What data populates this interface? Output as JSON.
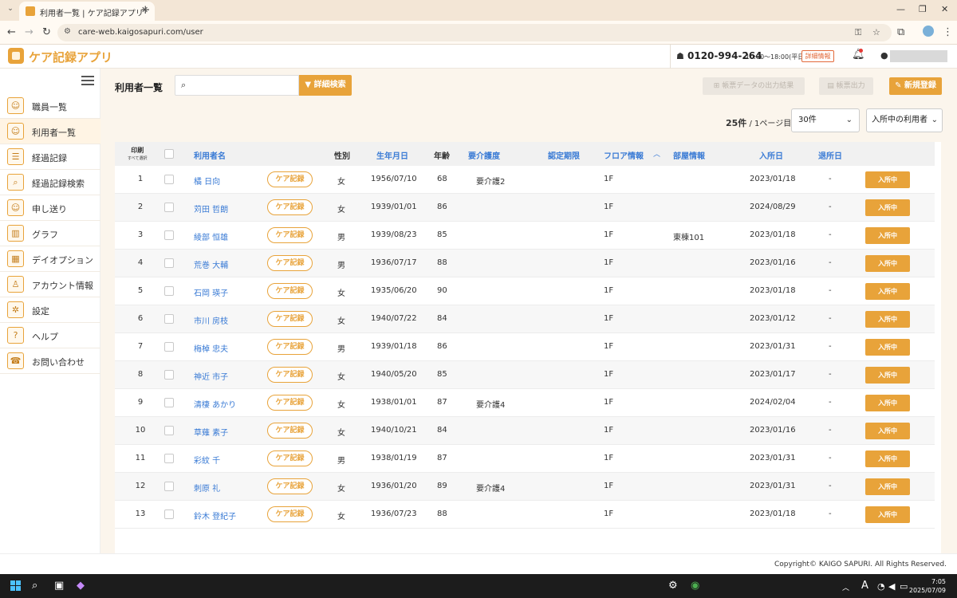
{
  "browser": {
    "tab_title": "利用者一覧 | ケア記録アプリ",
    "url": "care-web.kaigosapuri.com/user"
  },
  "header": {
    "app_name": "ケア記録アプリ",
    "phone": "0120-994-264",
    "hours": "10:00〜18:00(平日)",
    "detail_label": "詳細情報"
  },
  "sidebar": {
    "items": [
      {
        "label": "職員一覧",
        "icon": "staff-icon"
      },
      {
        "label": "利用者一覧",
        "icon": "user-list-icon"
      },
      {
        "label": "経過記録",
        "icon": "progress-record-icon"
      },
      {
        "label": "経過記録検索",
        "icon": "record-search-icon"
      },
      {
        "label": "申し送り",
        "icon": "handover-icon"
      },
      {
        "label": "グラフ",
        "icon": "graph-icon"
      },
      {
        "label": "デイオプション",
        "icon": "day-option-icon"
      },
      {
        "label": "アカウント情報",
        "icon": "account-icon"
      },
      {
        "label": "設定",
        "icon": "settings-icon"
      },
      {
        "label": "ヘルプ",
        "icon": "help-icon"
      },
      {
        "label": "お問い合わせ",
        "icon": "contact-icon"
      }
    ]
  },
  "main": {
    "title": "利用者一覧",
    "search_placeholder": "",
    "advanced_search": "詳細検索",
    "export_results": "帳票データの出力結果",
    "form_output": "帳票出力",
    "new_register": "新規登録",
    "count": "25件",
    "page_info": " / 1ページ目",
    "per_page": "30件",
    "filter": "入所中の利用者"
  },
  "table": {
    "headers": {
      "print": "印刷",
      "select_all": "すべて選択",
      "name": "利用者名",
      "gender": "性別",
      "birthdate": "生年月日",
      "age": "年齢",
      "care_level": "要介護度",
      "cert_period": "認定期限",
      "floor": "フロア情報",
      "room": "部屋情報",
      "admission": "入所日",
      "discharge": "退所日"
    },
    "care_button": "ケア記録",
    "status": "入所中",
    "rows": [
      {
        "no": "1",
        "name": "橘 日向",
        "gender": "女",
        "birth": "1956/07/10",
        "age": "68",
        "care": "要介護2",
        "floor": "1F",
        "room": "",
        "admit": "2023/01/18",
        "leave": "-"
      },
      {
        "no": "2",
        "name": "苅田 哲朗",
        "gender": "女",
        "birth": "1939/01/01",
        "age": "86",
        "care": "",
        "floor": "1F",
        "room": "",
        "admit": "2024/08/29",
        "leave": "-"
      },
      {
        "no": "3",
        "name": "綾部 恒雄",
        "gender": "男",
        "birth": "1939/08/23",
        "age": "85",
        "care": "",
        "floor": "1F",
        "room": "東棟101",
        "admit": "2023/01/18",
        "leave": "-"
      },
      {
        "no": "4",
        "name": "荒巻 大輔",
        "gender": "男",
        "birth": "1936/07/17",
        "age": "88",
        "care": "",
        "floor": "1F",
        "room": "",
        "admit": "2023/01/16",
        "leave": "-"
      },
      {
        "no": "5",
        "name": "石岡 瑛子",
        "gender": "女",
        "birth": "1935/06/20",
        "age": "90",
        "care": "",
        "floor": "1F",
        "room": "",
        "admit": "2023/01/18",
        "leave": "-"
      },
      {
        "no": "6",
        "name": "市川 房枝",
        "gender": "女",
        "birth": "1940/07/22",
        "age": "84",
        "care": "",
        "floor": "1F",
        "room": "",
        "admit": "2023/01/12",
        "leave": "-"
      },
      {
        "no": "7",
        "name": "梅棹 忠夫",
        "gender": "男",
        "birth": "1939/01/18",
        "age": "86",
        "care": "",
        "floor": "1F",
        "room": "",
        "admit": "2023/01/31",
        "leave": "-"
      },
      {
        "no": "8",
        "name": "神近 市子",
        "gender": "女",
        "birth": "1940/05/20",
        "age": "85",
        "care": "",
        "floor": "1F",
        "room": "",
        "admit": "2023/01/17",
        "leave": "-"
      },
      {
        "no": "9",
        "name": "清棲 あかり",
        "gender": "女",
        "birth": "1938/01/01",
        "age": "87",
        "care": "要介護4",
        "floor": "1F",
        "room": "",
        "admit": "2024/02/04",
        "leave": "-"
      },
      {
        "no": "10",
        "name": "草薙 素子",
        "gender": "女",
        "birth": "1940/10/21",
        "age": "84",
        "care": "",
        "floor": "1F",
        "room": "",
        "admit": "2023/01/16",
        "leave": "-"
      },
      {
        "no": "11",
        "name": "彩紋 千",
        "gender": "男",
        "birth": "1938/01/19",
        "age": "87",
        "care": "",
        "floor": "1F",
        "room": "",
        "admit": "2023/01/31",
        "leave": "-"
      },
      {
        "no": "12",
        "name": "刺原 礼",
        "gender": "女",
        "birth": "1936/01/20",
        "age": "89",
        "care": "要介護4",
        "floor": "1F",
        "room": "",
        "admit": "2023/01/31",
        "leave": "-"
      },
      {
        "no": "13",
        "name": "鈴木 登紀子",
        "gender": "女",
        "birth": "1936/07/23",
        "age": "88",
        "care": "",
        "floor": "1F",
        "room": "",
        "admit": "2023/01/18",
        "leave": "-"
      }
    ]
  },
  "footer": {
    "copyright": "Copyright© KAIGO SAPURI. All Rights Reserved."
  },
  "taskbar": {
    "time": "7:05",
    "date": "2025/07/09"
  }
}
